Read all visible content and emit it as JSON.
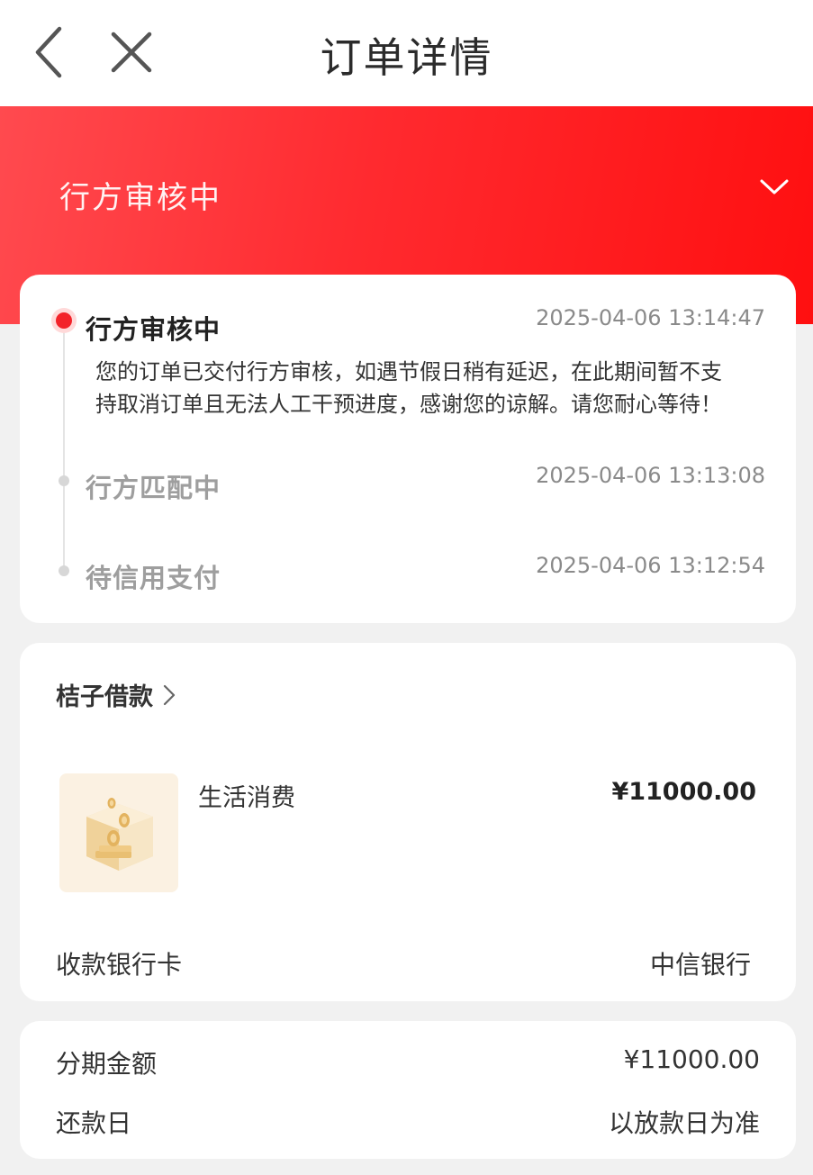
{
  "header": {
    "title": "订单详情"
  },
  "banner": {
    "status": "行方审核中"
  },
  "timeline": [
    {
      "title": "行方审核中",
      "time": "2025-04-06 13:14:47",
      "desc_line1": "您的订单已交付行方审核，如遇节假日稍有延迟，在此期间暂不支",
      "desc_line2": "持取消订单且无法人工干预进度，感谢您的谅解。请您耐心等待！"
    },
    {
      "title": "行方匹配中",
      "time": "2025-04-06 13:13:08"
    },
    {
      "title": "待信用支付",
      "time": "2025-04-06 13:12:54"
    }
  ],
  "loan": {
    "merchant": "桔子借款",
    "product_name": "生活消费",
    "product_amount": "¥11000.00",
    "bank_label": "收款银行卡",
    "bank_value": "中信银行"
  },
  "installment": {
    "amount_label": "分期金额",
    "amount_value": "¥11000.00",
    "repay_label": "还款日",
    "repay_value": "以放款日为准"
  },
  "colors": {
    "accent": "#ff1a1f",
    "active_dot": "#f3232a"
  }
}
